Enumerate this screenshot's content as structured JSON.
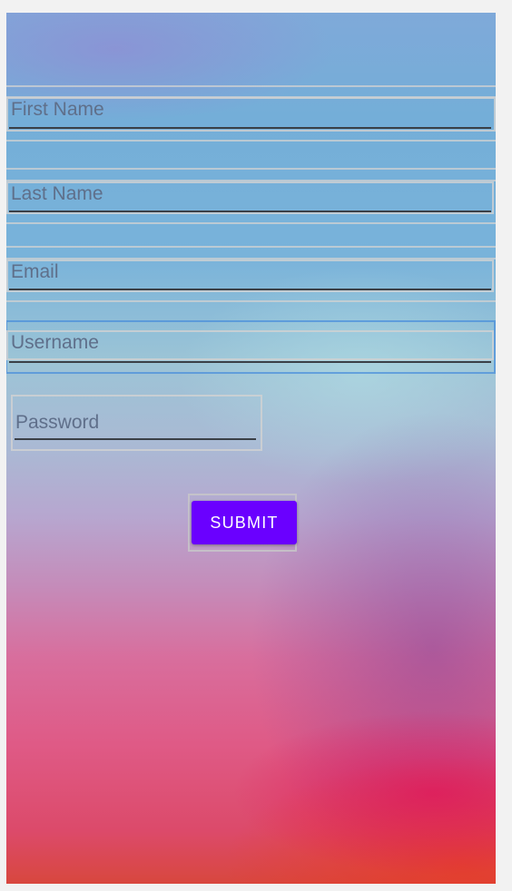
{
  "form": {
    "first_name": {
      "placeholder": "First Name"
    },
    "last_name": {
      "placeholder": "Last Name"
    },
    "email": {
      "placeholder": "Email"
    },
    "username": {
      "placeholder": "Username"
    },
    "password": {
      "placeholder": "Password"
    },
    "submit_label": "SUBMIT"
  },
  "colors": {
    "accent": "#6a00ff",
    "hint_text": "#5f6f8a",
    "underline": "#3b4047"
  }
}
